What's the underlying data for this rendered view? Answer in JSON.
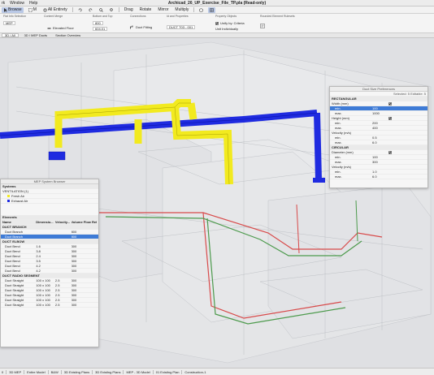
{
  "menu": {
    "items": [
      "rk",
      "Window",
      "Help"
    ],
    "title": "Archicad_26_UP_Exercise_File_TP.pla (Read-only)"
  },
  "toolbar": {
    "browse_label": "Browse",
    "m_label": "M",
    "all_label": "All Entirety",
    "drag_label": "Drag",
    "rotate_label": "Rotate",
    "mirror_label": "Mirror",
    "multiply_label": "Multiply"
  },
  "infobox": {
    "groups": {
      "mep_selection": "Flat Info Selection",
      "content": "Content Merge",
      "bottom_top": "Bottom and Top",
      "connections": "Connections",
      "layer_props": "Id and Properties",
      "property": "Property Objects",
      "ruleset": "Rounded Element Rulesets"
    },
    "layer_value": "MEP",
    "position_label": "Elevated Floor",
    "coords": {
      "a": "800",
      "b": "604.01"
    },
    "fitting_label": "Duct Fitting",
    "element_id": "DUCT T03 - 001",
    "unify_label": "Unify by: Criteria",
    "edit_label": "Unit Individually"
  },
  "viewtabs": [
    {
      "label": "3D / All",
      "active": true
    },
    {
      "label": "3D / MEP Ducts",
      "active": false
    },
    {
      "label": "Section Overview",
      "active": false
    }
  ],
  "duct_panel": {
    "title": "Duct Size Preferences",
    "selected_label": "Selected: 5 Editable: 5",
    "sections": [
      {
        "name": "RECTANGULAR",
        "rows": [
          {
            "label": "Width (mm)",
            "value": "",
            "checked": true
          },
          {
            "label": "min.",
            "value": "100",
            "selected": true
          },
          {
            "label": "max.",
            "value": "1000"
          },
          {
            "label": "Height (mm)",
            "value": "",
            "checked": true
          },
          {
            "label": "min.",
            "value": "200"
          },
          {
            "label": "max.",
            "value": "400"
          },
          {
            "label": "Velocity (m/s)",
            "value": ""
          },
          {
            "label": "min.",
            "value": "0.5"
          },
          {
            "label": "max.",
            "value": "6.0"
          }
        ]
      },
      {
        "name": "CIRCULAR",
        "rows": [
          {
            "label": "Diameter (mm)",
            "value": "",
            "checked": true
          },
          {
            "label": "min.",
            "value": "100"
          },
          {
            "label": "max.",
            "value": "300"
          },
          {
            "label": "Velocity (m/s)",
            "value": ""
          },
          {
            "label": "min.",
            "value": "1.0"
          },
          {
            "label": "max.",
            "value": "6.0"
          }
        ]
      }
    ]
  },
  "mep_browser": {
    "title": "MEP System Browser",
    "systems_label": "Systems",
    "systems_tree": [
      "VENTILATION (1)",
      "Fresh Air",
      "Exhaust Air"
    ],
    "elements_label": "Elements",
    "columns": [
      "Name",
      "Dimensio...",
      "Velocity...",
      "Volume Flow Ret..."
    ],
    "groups": [
      {
        "name": "DUCT BRANCH",
        "rows": [
          [
            "Duct Branch",
            "",
            "",
            "800"
          ],
          [
            "Duct Branch",
            "",
            "",
            "800"
          ]
        ]
      },
      {
        "name": "DUCT ELBOW",
        "rows": [
          [
            "Duct Bend",
            "1.6",
            "",
            "300"
          ],
          [
            "Duct Bend",
            "3.8",
            "",
            "300"
          ],
          [
            "Duct Bend",
            "2.4",
            "",
            "300"
          ],
          [
            "Duct Bend",
            "3.5",
            "",
            "300"
          ],
          [
            "Duct Bend",
            "4.2",
            "",
            "300"
          ],
          [
            "Duct Bend",
            "4.2",
            "",
            "300"
          ]
        ]
      },
      {
        "name": "DUCT RADIO SEGMENT",
        "rows": [
          [
            "Duct Straight",
            "100 x 100",
            "2.5",
            "300"
          ],
          [
            "Duct Straight",
            "100 x 100",
            "2.5",
            "300"
          ],
          [
            "Duct Straight",
            "100 x 100",
            "2.5",
            "300"
          ],
          [
            "Duct Straight",
            "100 x 100",
            "2.5",
            "300"
          ],
          [
            "Duct Straight",
            "100 x 100",
            "2.5",
            "300"
          ],
          [
            "Duct Straight",
            "100 x 100",
            "2.5",
            "300"
          ]
        ]
      }
    ]
  },
  "statusbar": {
    "zoom": "0",
    "layer": "3D MEP",
    "pen": "Entire Model",
    "model": "B&W",
    "view": "3D Existing Plans",
    "filter": "3D Existing Plans",
    "override": "MEP - 3D Model",
    "plan": "01 Existing Plan",
    "construction": "Construction-1"
  },
  "colors": {
    "supply_duct": "#f2ea1f",
    "return_duct": "#1f2be0",
    "red_pipe": "#d84a4a",
    "green_pipe": "#4c9a4c",
    "selection": "#3e7bd6"
  }
}
